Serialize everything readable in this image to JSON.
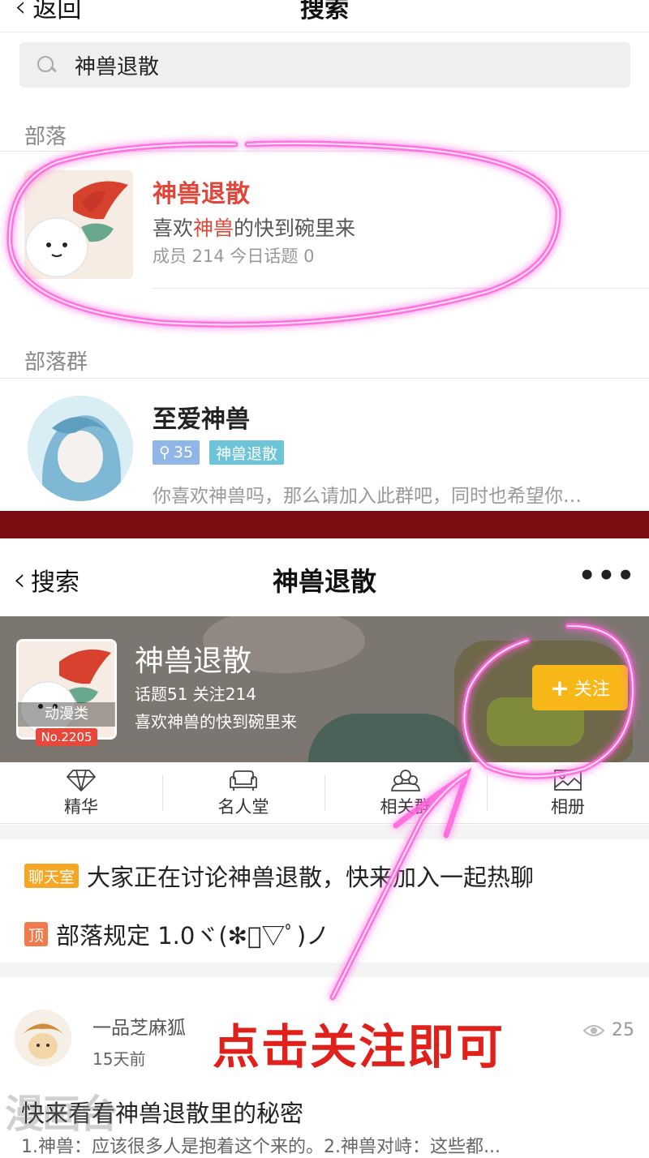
{
  "screen1": {
    "nav": {
      "back_label": "返回",
      "title": "搜索"
    },
    "search": {
      "query": "神兽退散"
    },
    "section_tribe": "部落",
    "tribe_result": {
      "name": "神兽退散",
      "desc_prefix": "喜欢",
      "desc_highlight": "神兽",
      "desc_suffix": "的快到碗里来",
      "meta": "成员 214 今日话题 0"
    },
    "section_group": "部落群",
    "group_result": {
      "name": "至爱神兽",
      "member_count": "35",
      "tribe_tag": "神兽退散",
      "desc": "你喜欢神兽吗，那么请加入此群吧，同时也希望你…"
    }
  },
  "screen2": {
    "nav": {
      "back_label": "搜索",
      "title": "神兽退散",
      "more": "•••"
    },
    "header": {
      "name": "神兽退散",
      "stats": "话题51  关注214",
      "desc": "喜欢神兽的快到碗里来",
      "category": "动漫类",
      "rank": "No.2205",
      "follow_label": "关注"
    },
    "tabs": [
      {
        "label": "精华",
        "icon": "diamond-icon"
      },
      {
        "label": "名人堂",
        "icon": "sofa-icon"
      },
      {
        "label": "相关群",
        "icon": "group-icon"
      },
      {
        "label": "相册",
        "icon": "image-icon"
      }
    ],
    "notices": [
      {
        "tag": "聊天室",
        "text": "大家正在讨论神兽退散，快来加入一起热聊"
      },
      {
        "tag": "顶",
        "text": "部落规定 1.0ヾ(✻ﾟ▽ﾟ)ノ"
      }
    ],
    "post": {
      "author": "一品芝麻狐",
      "time": "15天前",
      "views": "25",
      "title": "快来看看神兽退散里的秘密",
      "excerpt": "1.神兽：应该很多人是抱着这个来的。2.神兽对峙：这些都..."
    }
  },
  "annotation": {
    "text": "点击关注即可"
  },
  "watermark": "漫画台",
  "colors": {
    "highlight_red": "#e0463a",
    "follow_yellow": "#f7b719",
    "separator": "#7a0c12",
    "annotation_pink": "#ff4fd8",
    "annotation_red": "#e0201b"
  }
}
